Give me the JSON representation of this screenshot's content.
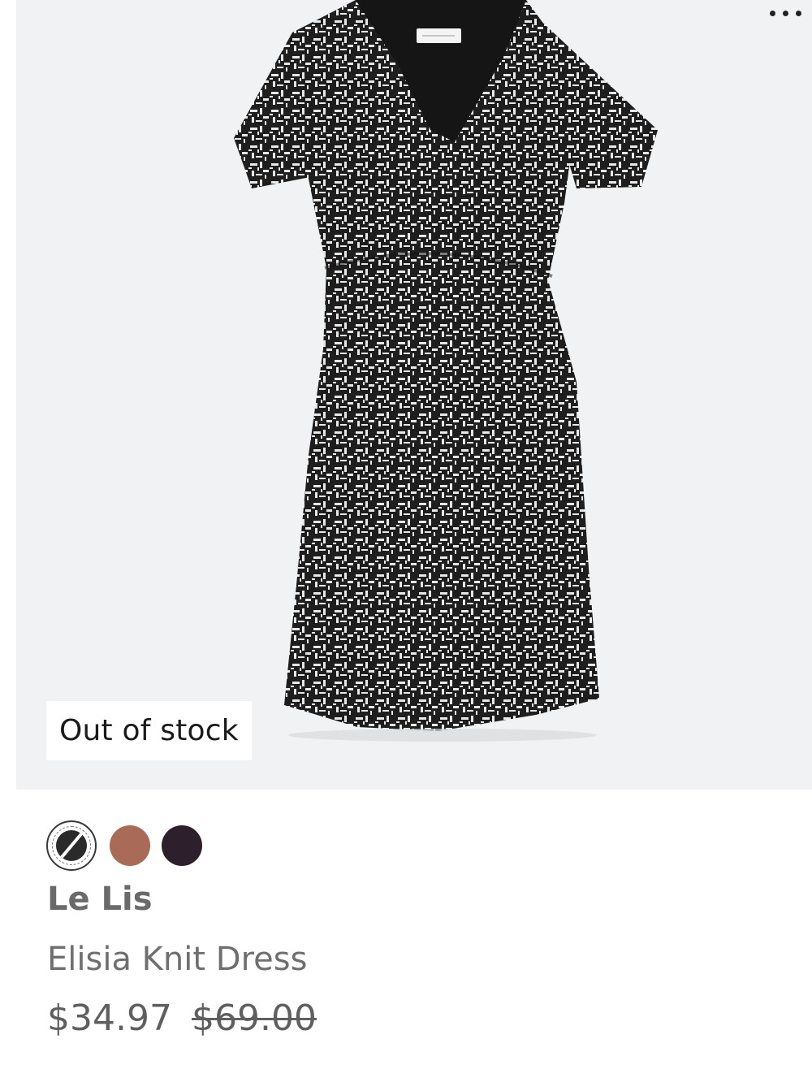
{
  "image": {
    "alt": "Black and white knit dress"
  },
  "menu": {
    "icon": "more-horizontal-icon"
  },
  "badge": {
    "label": "Out of stock"
  },
  "swatches": [
    {
      "color": "#2a2a2a",
      "selected": true,
      "icon": "black-white-print-swatch"
    },
    {
      "color": "#a96a57",
      "selected": false
    },
    {
      "color": "#2d1f2b",
      "selected": false
    }
  ],
  "product": {
    "brand": "Le Lis",
    "name": "Elisia Knit Dress",
    "price": "$34.97",
    "original_price": "$69.00"
  }
}
